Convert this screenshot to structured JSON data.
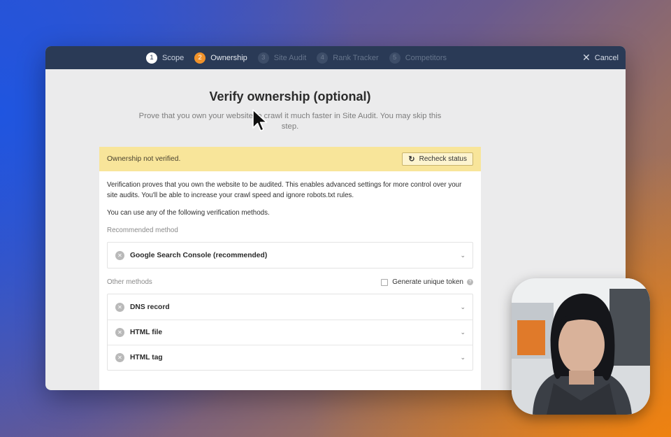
{
  "steps": [
    {
      "num": "1",
      "label": "Scope",
      "state": "done"
    },
    {
      "num": "2",
      "label": "Ownership",
      "state": "active"
    },
    {
      "num": "3",
      "label": "Site Audit",
      "state": "todo"
    },
    {
      "num": "4",
      "label": "Rank Tracker",
      "state": "todo"
    },
    {
      "num": "5",
      "label": "Competitors",
      "state": "todo"
    }
  ],
  "cancel_label": "Cancel",
  "title": "Verify ownership (optional)",
  "subtitle": "Prove that you own your website to crawl it much faster in Site Audit. You may skip this step.",
  "banner": {
    "status": "Ownership not verified.",
    "recheck_label": "Recheck status",
    "color": "#f8e59a"
  },
  "description": "Verification proves that you own the website to be audited. This enables advanced settings for more control over your site audits. You'll be able to increase your crawl speed and ignore robots.txt rules.",
  "methods_intro": "You can use any of the following verification methods.",
  "recommended_heading": "Recommended method",
  "recommended_methods": [
    {
      "label": "Google Search Console (recommended)"
    }
  ],
  "other_heading": "Other methods",
  "generate_token_label": "Generate unique token",
  "other_methods": [
    {
      "label": "DNS record"
    },
    {
      "label": "HTML file"
    },
    {
      "label": "HTML tag"
    }
  ],
  "colors": {
    "topbar": "#2a3a56",
    "accent_active_step": "#f0922b"
  }
}
